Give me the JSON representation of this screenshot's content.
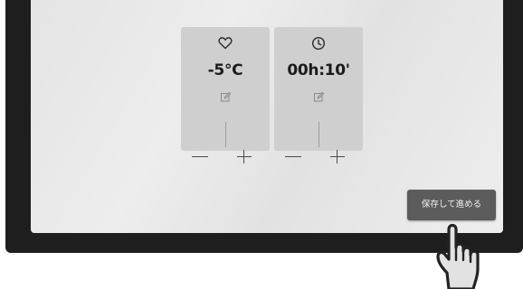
{
  "cards": {
    "temperature": {
      "icon": "heart-icon",
      "value": "-5°C",
      "edit_icon": "edit-icon",
      "decrement_icon": "minus-icon",
      "increment_icon": "plus-icon"
    },
    "time": {
      "icon": "clock-icon",
      "value": "00h:10'",
      "edit_icon": "edit-icon",
      "decrement_icon": "minus-icon",
      "increment_icon": "plus-icon"
    }
  },
  "actions": {
    "save_label": "保存して進める"
  },
  "overlay": {
    "icon": "pointing-hand-icon"
  },
  "colors": {
    "bezel": "#1e1e1e",
    "screen": "#e8e8e8",
    "card": "#cfcfcf",
    "button": "#5c5c5c",
    "button_text": "#f2f2f2"
  }
}
